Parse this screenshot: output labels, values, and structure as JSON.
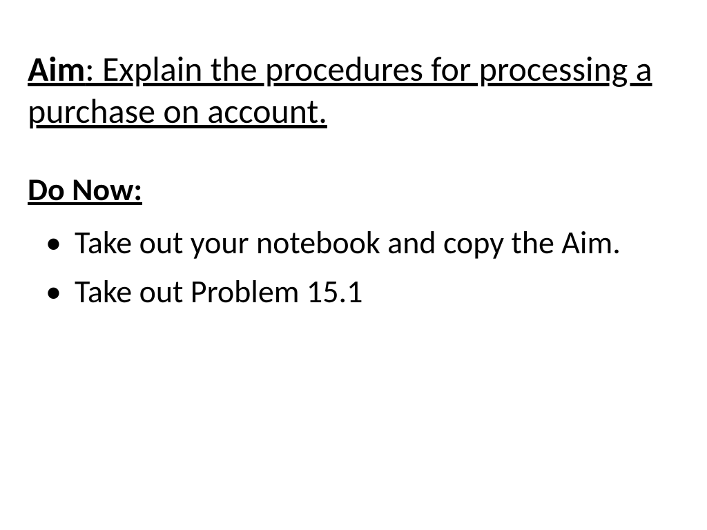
{
  "title": {
    "label_bold": "Aim",
    "label_rest": ": Explain the procedures for processing a purchase on account."
  },
  "do_now": {
    "heading": "Do Now:",
    "items": [
      "Take out your notebook and copy the Aim.",
      "Take out Problem 15.1"
    ]
  }
}
